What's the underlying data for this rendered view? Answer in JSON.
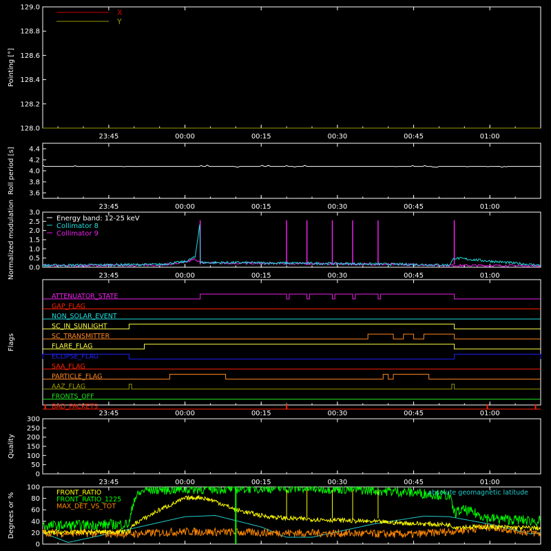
{
  "colors": {
    "background": "#000000",
    "axes": "#ffffff",
    "x": "#cc0000",
    "y": "#999900",
    "roll": "#ffffff",
    "energy": "#ffffff",
    "coll8": "#22dddd",
    "coll9": "#ee22ee",
    "front_ratio": "#ffff00",
    "front_ratio_1225": "#00ff00",
    "max_det": "#ff8800",
    "geomag": "#22cccc"
  },
  "time_ticks": [
    "23:45",
    "00:00",
    "00:15",
    "00:30",
    "00:45",
    "01:00"
  ],
  "chart_data": [
    {
      "id": "pointing",
      "type": "line",
      "ylabel": "Pointing [°]",
      "ylim": [
        128.0,
        129.0
      ],
      "yticks": [
        "129.0",
        "128.8",
        "128.6",
        "128.4",
        "128.2",
        "128.0"
      ],
      "legend": [
        {
          "name": "X",
          "color": "#cc0000"
        },
        {
          "name": "Y",
          "color": "#999900"
        }
      ],
      "series": [
        {
          "name": "X",
          "x": [
            "23:32",
            "01:10"
          ],
          "y": [
            128.0,
            128.0
          ]
        },
        {
          "name": "Y",
          "x": [
            "23:32",
            "01:10"
          ],
          "y": [
            128.0,
            128.0
          ]
        }
      ]
    },
    {
      "id": "roll",
      "type": "line",
      "ylabel": "Roll period [s]",
      "ylim": [
        3.5,
        4.5
      ],
      "yticks": [
        "4.4",
        "4.2",
        "4.0",
        "3.8",
        "3.6"
      ],
      "series": [
        {
          "name": "",
          "x": [
            "23:32",
            "01:10"
          ],
          "y": [
            4.08,
            4.08
          ]
        }
      ]
    },
    {
      "id": "modulation",
      "type": "line",
      "ylabel": "Normalized modulation",
      "ylim": [
        0.0,
        3.0
      ],
      "yticks": [
        "3.0",
        "2.5",
        "2.0",
        "1.5",
        "1.0",
        "0.5",
        "0.0"
      ],
      "legend": [
        {
          "name": "Energy band: 12-25 keV",
          "color": "#ffffff"
        },
        {
          "name": "Collimator 8",
          "color": "#22dddd"
        },
        {
          "name": "Collimator 9",
          "color": "#ee22ee"
        }
      ],
      "series": [
        {
          "name": "Collimator 8",
          "x": [
            "23:32",
            "23:55",
            "00:00",
            "00:02",
            "00:03",
            "00:03",
            "00:10",
            "00:30",
            "00:45",
            "00:52",
            "00:53",
            "01:10"
          ],
          "y": [
            0.1,
            0.15,
            0.3,
            0.55,
            2.55,
            0.25,
            0.25,
            0.2,
            0.15,
            0.12,
            0.5,
            0.1
          ]
        },
        {
          "name": "Collimator 9",
          "spikes": [
            "00:03",
            "00:20",
            "00:24",
            "00:29",
            "00:33",
            "00:38",
            "00:53"
          ],
          "spike_value": 2.55,
          "x": [
            "23:32",
            "23:55",
            "00:00",
            "00:02",
            "00:03",
            "00:10",
            "00:30",
            "00:45",
            "00:52",
            "01:10"
          ],
          "y": [
            0.08,
            0.12,
            0.25,
            0.45,
            0.25,
            0.22,
            0.18,
            0.14,
            0.1,
            0.08
          ]
        }
      ]
    },
    {
      "id": "flags",
      "type": "line",
      "ylabel": "Flags",
      "flags": [
        {
          "name": "ATTENUATOR_STATE",
          "color": "#ee22ee",
          "on": [
            [
              "00:03",
              "00:20"
            ],
            [
              "00:20.5",
              "00:24"
            ],
            [
              "00:24.5",
              "00:29"
            ],
            [
              "00:29.5",
              "00:33"
            ],
            [
              "00:33.5",
              "00:38"
            ],
            [
              "00:38.5",
              "00:53"
            ]
          ]
        },
        {
          "name": "GAP_FLAG",
          "color": "#ff2200",
          "on": []
        },
        {
          "name": "NON_SOLAR_EVENT",
          "color": "#22dddd",
          "on": []
        },
        {
          "name": "SC_IN_SUNLIGHT",
          "color": "#ffff44",
          "on": [
            [
              "23:49",
              "00:53"
            ]
          ]
        },
        {
          "name": "SC_TRANSMITTER",
          "color": "#ff8822",
          "on": [
            [
              "00:36",
              "00:41"
            ],
            [
              "00:43",
              "00:45"
            ],
            [
              "00:47",
              "00:53"
            ]
          ]
        },
        {
          "name": "FLARE_FLAG",
          "color": "#ffff44",
          "on": [
            [
              "23:52",
              "00:53"
            ]
          ]
        },
        {
          "name": "ECLIPSE_FLAG",
          "color": "#2222ff",
          "on": [
            [
              "23:32",
              "23:49"
            ],
            [
              "00:53",
              "01:10"
            ]
          ]
        },
        {
          "name": "SAA_FLAG",
          "color": "#ff2200",
          "on": []
        },
        {
          "name": "PARTICLE_FLAG",
          "color": "#ff8822",
          "on": [
            [
              "23:57",
              "00:08"
            ],
            [
              "00:39",
              "00:40"
            ],
            [
              "00:41",
              "00:48"
            ]
          ]
        },
        {
          "name": "AAZ_FLAG",
          "color": "#999900",
          "on": [
            [
              "23:49",
              "23:49.5"
            ],
            [
              "00:52.5",
              "00:53"
            ]
          ]
        },
        {
          "name": "FRONTS_OFF",
          "color": "#22dd22",
          "on": []
        },
        {
          "name": "BAD_PACKETS",
          "color": "#ff2200",
          "spikes": [
            "23:32.5",
            "00:20",
            "00:59.5",
            "01:09"
          ]
        }
      ]
    },
    {
      "id": "quality",
      "type": "line",
      "ylabel": "Quality",
      "ylim": [
        0,
        300
      ],
      "yticks": [
        "300",
        "250",
        "200",
        "150",
        "100",
        "50",
        "0"
      ],
      "series": []
    },
    {
      "id": "ratios",
      "type": "line",
      "ylabel": "Degrees or %",
      "ylim": [
        0,
        100
      ],
      "yticks": [
        "100",
        "80",
        "60",
        "40",
        "20",
        "0"
      ],
      "legend": [
        {
          "name": "FRONT_RATIO",
          "color": "#ffff00"
        },
        {
          "name": "FRONT_RATIO_1225",
          "color": "#00ff00"
        },
        {
          "name": "MAX_DET_VS_TOT",
          "color": "#ff8800"
        }
      ],
      "legend_right": "absolute geomagnetic latitude",
      "series": [
        {
          "name": "FRONT_RATIO",
          "x": [
            "23:32",
            "23:49",
            "23:50",
            "23:55",
            "00:00",
            "00:03",
            "00:06",
            "00:10",
            "00:15",
            "00:20",
            "00:30",
            "00:40",
            "00:45",
            "00:52",
            "00:53",
            "01:00",
            "01:10"
          ],
          "y": [
            20,
            22,
            35,
            60,
            80,
            82,
            75,
            60,
            50,
            45,
            42,
            38,
            36,
            34,
            30,
            30,
            28
          ]
        },
        {
          "name": "FRONT_RATIO_1225",
          "x": [
            "23:32",
            "23:49",
            "23:50",
            "23:52",
            "00:00",
            "00:15",
            "00:30",
            "00:40",
            "00:45",
            "00:52",
            "00:53",
            "00:55",
            "01:00",
            "01:10"
          ],
          "y": [
            32,
            35,
            80,
            95,
            96,
            98,
            97,
            93,
            90,
            85,
            55,
            60,
            45,
            40
          ]
        },
        {
          "name": "MAX_DET_VS_TOT",
          "x": [
            "23:32",
            "23:50",
            "00:00",
            "00:15",
            "00:30",
            "00:45",
            "00:53",
            "01:00",
            "01:10"
          ],
          "y": [
            20,
            18,
            22,
            20,
            19,
            17,
            23,
            30,
            18
          ]
        },
        {
          "name": "absolute geomagnetic latitude",
          "x": [
            "23:32",
            "23:37",
            "23:46",
            "00:00",
            "00:06",
            "00:15",
            "00:20",
            "00:25",
            "00:37",
            "00:47",
            "00:52",
            "01:00",
            "01:08",
            "01:10"
          ],
          "y": [
            20,
            3,
            20,
            48,
            50,
            30,
            12,
            12,
            35,
            49,
            48,
            35,
            18,
            20
          ]
        }
      ]
    }
  ]
}
